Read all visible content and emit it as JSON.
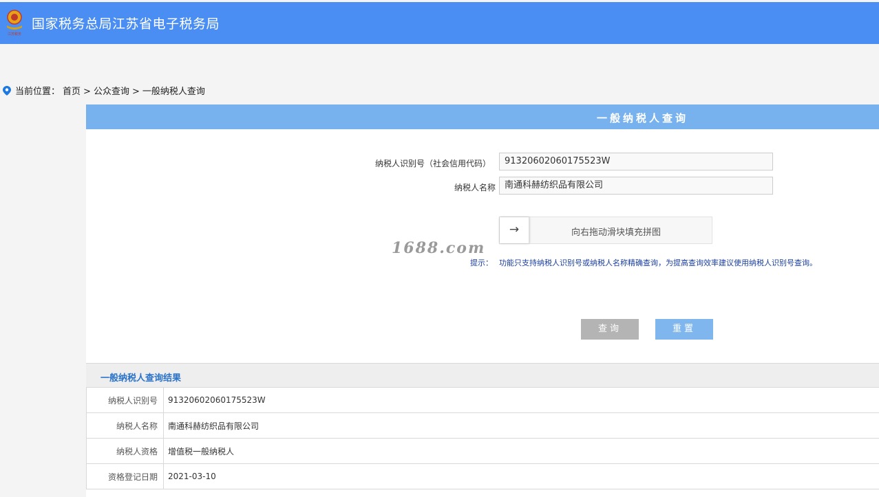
{
  "header": {
    "logo_text": "江苏税务",
    "title": "国家税务总局江苏省电子税务局"
  },
  "breadcrumb": {
    "prefix": "当前位置：",
    "items": [
      "首页",
      ">",
      "公众查询",
      ">",
      "一般纳税人查询"
    ]
  },
  "panel": {
    "title": "一般纳税人查询",
    "fields": [
      {
        "label": "纳税人识别号（社会信用代码）",
        "value": "91320602060175523W"
      },
      {
        "label": "纳税人名称",
        "value": "南通科赫纺织品有限公司"
      }
    ],
    "slider": {
      "arrow": "→",
      "text": "向右拖动滑块填充拼图"
    },
    "watermark": "1688.com",
    "hint_label": "提示：",
    "hint_text": "功能只支持纳税人识别号或纳税人名称精确查询，为提高查询效率建议使用纳税人识别号查询。",
    "buttons": {
      "query": "查询",
      "reset": "重置"
    }
  },
  "result": {
    "title": "一般纳税人查询结果",
    "rows": [
      {
        "key": "纳税人识别号",
        "value": "91320602060175523W"
      },
      {
        "key": "纳税人名称",
        "value": "南通科赫纺织品有限公司"
      },
      {
        "key": "纳税人资格",
        "value": "增值税一般纳税人"
      },
      {
        "key": "资格登记日期",
        "value": "2021-03-10"
      }
    ]
  },
  "colors": {
    "header_bg": "#4a8ef4",
    "panel_title_bg": "#78b2ee",
    "query_button": "#b4b4b4",
    "reset_button": "#80b6ee",
    "hint_text": "#1a3ea1",
    "result_title": "#2a73c8"
  }
}
